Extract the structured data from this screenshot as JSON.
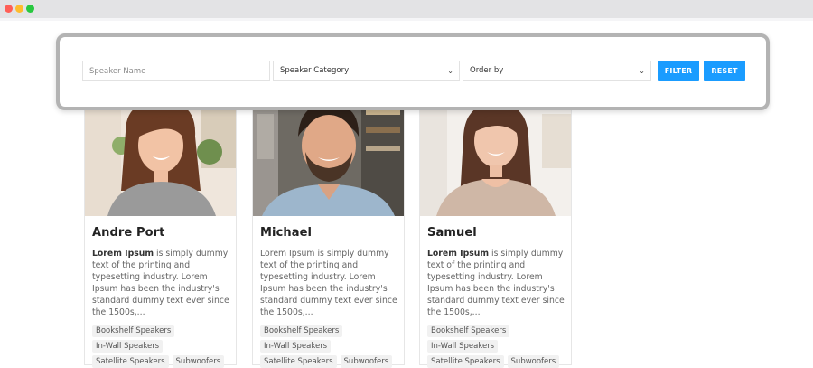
{
  "filters": {
    "speaker_name_placeholder": "Speaker Name",
    "category_value": "Speaker Category",
    "order_value": "Order by",
    "filter_label": "FILTER",
    "reset_label": "RESET"
  },
  "cards": [
    {
      "name": "Andre Port",
      "desc_bold": "Lorem Ipsum",
      "desc_rest": " is simply dummy text of the printing and typesetting industry. Lorem Ipsum has been the industry's standard dummy text ever since the 1500s,...",
      "tags": [
        "Bookshelf Speakers",
        "In-Wall Speakers",
        "Satellite Speakers",
        "Subwoofers"
      ]
    },
    {
      "name": "Michael",
      "desc_bold": "",
      "desc_rest": "Lorem Ipsum is simply dummy text of the printing and typesetting industry. Lorem Ipsum has been the industry's standard dummy text ever since the 1500s,...",
      "tags": [
        "Bookshelf Speakers",
        "In-Wall Speakers",
        "Satellite Speakers",
        "Subwoofers"
      ]
    },
    {
      "name": "Samuel",
      "desc_bold": "Lorem Ipsum",
      "desc_rest": " is simply dummy text of the printing and typesetting industry. Lorem Ipsum has been the industry's standard dummy text ever since the 1500s,...",
      "tags": [
        "Bookshelf Speakers",
        "In-Wall Speakers",
        "Satellite Speakers",
        "Subwoofers"
      ]
    }
  ],
  "colors": {
    "accent": "#1a9cff",
    "highlight_border": "#b3b3b3"
  },
  "icons": {
    "dropdown": "chevron-down-icon"
  }
}
